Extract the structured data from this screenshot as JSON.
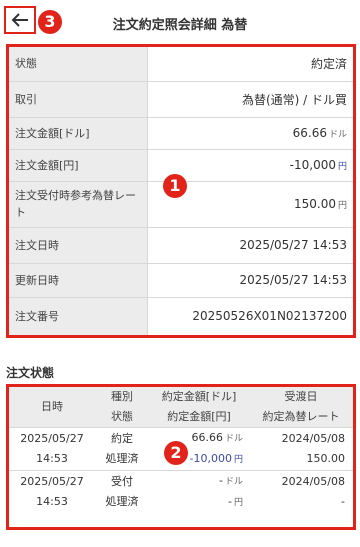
{
  "header": {
    "title": "注文約定照会詳細 為替",
    "back_icon": "arrow-left-icon"
  },
  "badges": [
    "1",
    "2",
    "3"
  ],
  "detail": {
    "rows": [
      {
        "label": "状態",
        "value": "約定済"
      },
      {
        "label": "取引",
        "value": "為替(通常) / ドル買"
      },
      {
        "label": "注文金額[ドル]",
        "value": "66.66",
        "unit": "ドル"
      },
      {
        "label": "注文金額[円]",
        "value": "-10,000",
        "unit": "円"
      },
      {
        "label": "注文受付時参考為替レート",
        "value": "150.00",
        "unit": "円"
      },
      {
        "label": "注文日時",
        "value": "2025/05/27 14:53"
      },
      {
        "label": "更新日時",
        "value": "2025/05/27 14:53"
      },
      {
        "label": "注文番号",
        "value": "20250526X01N02137200"
      }
    ]
  },
  "order_status": {
    "title": "注文状態",
    "headers": {
      "col1": "日時",
      "col2_top": "種別",
      "col2_bottom": "状態",
      "col3_top": "約定金額[ドル]",
      "col3_bottom": "約定金額[円]",
      "col4_top": "受渡日",
      "col4_bottom": "約定為替レート"
    },
    "rows": [
      {
        "date": "2025/05/27",
        "time": "14:53",
        "type": "約定",
        "status": "処理済",
        "amount_usd": "66.66",
        "amount_usd_unit": "ドル",
        "amount_jpy": "-10,000",
        "amount_jpy_unit": "円",
        "delivery_date": "2024/05/08",
        "rate": "150.00"
      },
      {
        "date": "2025/05/27",
        "time": "14:53",
        "type": "受付",
        "status": "処理済",
        "amount_usd": "-",
        "amount_usd_unit": "ドル",
        "amount_jpy": "-",
        "amount_jpy_unit": "円",
        "delivery_date": "2024/05/08",
        "rate": "-"
      }
    ]
  },
  "colors": {
    "highlight": "#e2231a",
    "label_bg": "#ececec",
    "negative": "#3b4aa8"
  }
}
